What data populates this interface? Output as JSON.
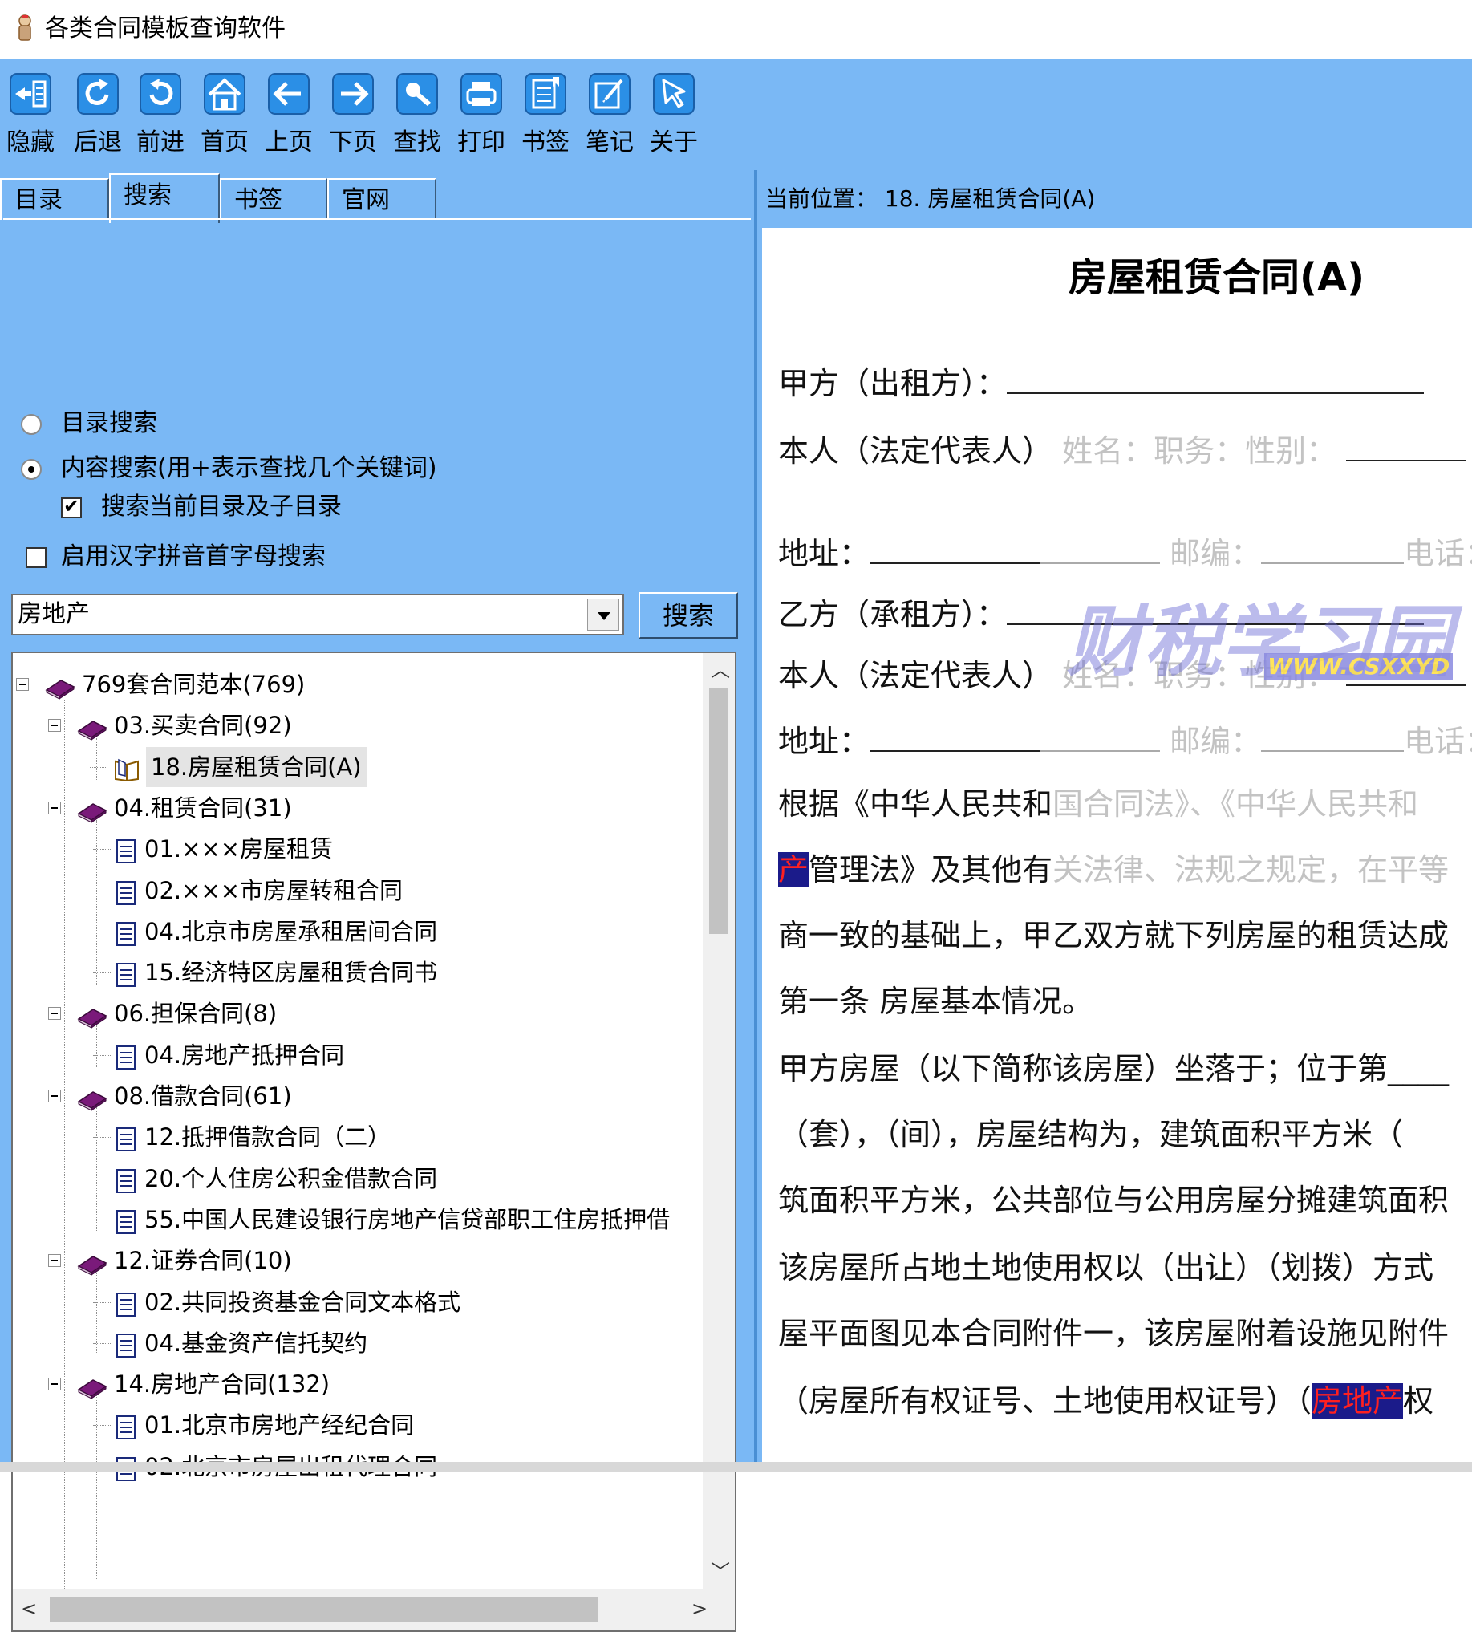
{
  "window": {
    "title": "各类合同模板查询软件"
  },
  "toolbar": {
    "buttons": [
      {
        "label": "隐藏",
        "icon": "hide-icon"
      },
      {
        "label": "后退",
        "icon": "back-refresh-icon"
      },
      {
        "label": "前进",
        "icon": "forward-refresh-icon"
      },
      {
        "label": "首页",
        "icon": "home-icon"
      },
      {
        "label": "上页",
        "icon": "arrow-left-icon"
      },
      {
        "label": "下页",
        "icon": "arrow-right-icon"
      },
      {
        "label": "查找",
        "icon": "magnifier-icon"
      },
      {
        "label": "打印",
        "icon": "printer-icon"
      },
      {
        "label": "书签",
        "icon": "bookmark-icon"
      },
      {
        "label": "笔记",
        "icon": "note-icon"
      },
      {
        "label": "关于",
        "icon": "cursor-icon"
      }
    ]
  },
  "tabs": [
    {
      "label": "目录"
    },
    {
      "label": "搜索",
      "active": true
    },
    {
      "label": "书签"
    },
    {
      "label": "官网"
    }
  ],
  "search": {
    "option_catalog": "目录搜索",
    "option_content": "内容搜索(用+表示查找几个关键词)",
    "option_subdir": "搜索当前目录及子目录",
    "option_pinyin": "启用汉字拼音首字母搜索",
    "selected_option": "content",
    "subdir_checked": true,
    "pinyin_checked": false,
    "query": "房地产",
    "button_label": "搜索"
  },
  "tree": {
    "root": "769套合同范本(769)",
    "items": [
      {
        "label": "03.买卖合同(92)",
        "type": "folder"
      },
      {
        "label": "18.房屋租赁合同(A)",
        "type": "open-doc",
        "selected": true
      },
      {
        "label": "04.租赁合同(31)",
        "type": "folder"
      },
      {
        "label": "01.×××房屋租赁",
        "type": "doc"
      },
      {
        "label": "02.×××市房屋转租合同",
        "type": "doc"
      },
      {
        "label": "04.北京市房屋承租居间合同",
        "type": "doc"
      },
      {
        "label": "15.经济特区房屋租赁合同书",
        "type": "doc"
      },
      {
        "label": "06.担保合同(8)",
        "type": "folder"
      },
      {
        "label": "04.房地产抵押合同",
        "type": "doc"
      },
      {
        "label": "08.借款合同(61)",
        "type": "folder"
      },
      {
        "label": "12.抵押借款合同（二）",
        "type": "doc"
      },
      {
        "label": "20.个人住房公积金借款合同",
        "type": "doc"
      },
      {
        "label": "55.中国人民建设银行房地产信贷部职工住房抵押借",
        "type": "doc"
      },
      {
        "label": "12.证券合同(10)",
        "type": "folder"
      },
      {
        "label": "02.共同投资基金合同文本格式",
        "type": "doc"
      },
      {
        "label": "04.基金资产信托契约",
        "type": "doc"
      },
      {
        "label": "14.房地产合同(132)",
        "type": "folder"
      },
      {
        "label": "01.北京市房地产经纪合同",
        "type": "doc"
      },
      {
        "label": "02.北京市房屋出租代理合同",
        "type": "doc"
      }
    ]
  },
  "location": {
    "prefix": "当前位置：",
    "path": "18. 房屋租赁合同(A)"
  },
  "document": {
    "title": "房屋租赁合同(A)",
    "party_a": "甲方（出租方）：",
    "rep_label": "本人（法定代表人）",
    "rep_fields": "姓名：职务：性别：",
    "address": "地址：",
    "postcode": "邮编：",
    "phone": "电话：",
    "party_b": "乙方（承租方）：",
    "basis_1a": "根据《中华人民共和",
    "basis_1b": "国合同法》、《中华人民共和",
    "basis_2_hl": "产",
    "basis_2a": "管理法》及其他有",
    "basis_2b": "关法律、法规之规定，在平等",
    "basis_3": "商一致的基础上，甲乙双方就下列房屋的租赁达成",
    "article_1": "第一条 房屋基本情况。",
    "house_1": "甲方房屋（以下简称该房屋）坐落于；位于第____",
    "house_2": "（套），（间），房屋结构为，建筑面积平方米（",
    "house_3": "筑面积平方米，公共部位与公用房屋分摊建筑面积",
    "house_4": "该房屋所占地土地使用权以（出让）（划拨）方式",
    "house_5": "屋平面图见本合同附件一，该房屋附着设施见附件",
    "house_6a": "（房屋所有权证号、土地使用权证号）（",
    "house_6_hl": "房地产",
    "house_6b": "权",
    "watermark_main": "财税学习园",
    "watermark_sub": "WWW.CSXXYD"
  },
  "colors": {
    "panel": "#7ab8f5",
    "highlight_bg": "#1b1b8a",
    "highlight_fg": "#ff2020"
  }
}
